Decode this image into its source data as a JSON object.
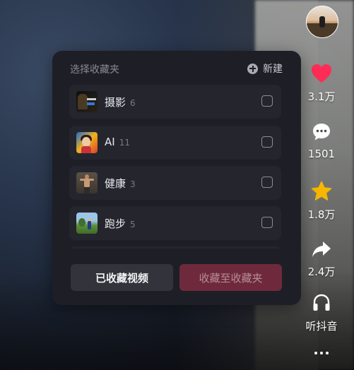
{
  "rail": {
    "like_count": "3.1万",
    "comment_count": "1501",
    "favorite_count": "1.8万",
    "share_count": "2.4万",
    "listen_label": "听抖音",
    "colors": {
      "like": "#ff2d55",
      "favorite": "#f5b700"
    }
  },
  "dialog": {
    "title": "选择收藏夹",
    "new_label": "新建",
    "folders": [
      {
        "name": "摄影",
        "count": "6",
        "icon": "photography-thumbnail"
      },
      {
        "name": "AI",
        "count": "11",
        "icon": "ai-thumbnail"
      },
      {
        "name": "健康",
        "count": "3",
        "icon": "health-thumbnail"
      },
      {
        "name": "跑步",
        "count": "5",
        "icon": "running-thumbnail"
      }
    ],
    "saved_videos_label": "已收藏视频",
    "collect_to_folder_label": "收藏至收藏夹",
    "accent_color": "#6e2a3c"
  }
}
